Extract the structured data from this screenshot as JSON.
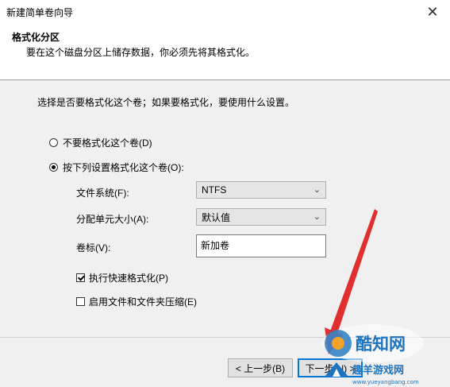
{
  "window": {
    "title": "新建简单卷向导",
    "close_symbol": "✕"
  },
  "header": {
    "title": "格式化分区",
    "description": "要在这个磁盘分区上储存数据，你必须先将其格式化。"
  },
  "intro_text": "选择是否要格式化这个卷；如果要格式化，要使用什么设置。",
  "options": {
    "no_format": {
      "label": "不要格式化这个卷(D)",
      "checked": false
    },
    "format_with": {
      "label": "按下列设置格式化这个卷(O):",
      "checked": true
    }
  },
  "fields": {
    "filesystem": {
      "label": "文件系统(F):",
      "value": "NTFS"
    },
    "allocation": {
      "label": "分配单元大小(A):",
      "value": "默认值"
    },
    "volume_label": {
      "label": "卷标(V):",
      "value": "新加卷"
    }
  },
  "checkboxes": {
    "quick_format": {
      "label": "执行快速格式化(P)",
      "checked": true
    },
    "compression": {
      "label": "启用文件和文件夹压缩(E)",
      "checked": false
    }
  },
  "buttons": {
    "back": "< 上一步(B)",
    "next": "下一步(N) >"
  },
  "watermark": {
    "brand": "酷知网",
    "site_cn": "趣羊游戏网",
    "site_url": "www.yueyangbang.com"
  },
  "colors": {
    "annotation_arrow": "#e01e1e",
    "primary_border": "#0078d7",
    "watermark_blue": "#1e73be"
  }
}
